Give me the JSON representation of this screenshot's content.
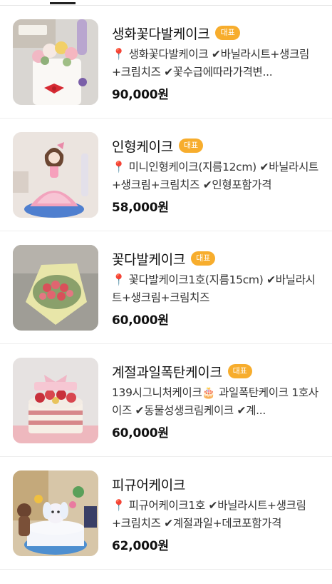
{
  "menu": {
    "items": [
      {
        "name": "생화꽃다발케이크",
        "badge": "대표",
        "description": "📍 생화꽃다발케이크 ✔바닐라시트+생크림+크림치즈 ✔꽃수급에따라가격변...",
        "price": "90,000원",
        "image_icon": "cake-flower-bouquet-photo"
      },
      {
        "name": "인형케이크",
        "badge": "대표",
        "description": "📍 미니인형케이크(지름12cm) ✔바닐라시트+생크림+크림치즈 ✔인형포함가격",
        "price": "58,000원",
        "image_icon": "doll-cake-photo"
      },
      {
        "name": "꽃다발케이크",
        "badge": "대표",
        "description": "📍 꽃다발케이크1호(지름15cm) ✔바닐라시트+생크림+크림치즈",
        "price": "60,000원",
        "image_icon": "flower-bouquet-cake-photo"
      },
      {
        "name": "계절과일폭탄케이크",
        "badge": "대표",
        "description": "139시그니처케이크🎂 과일폭탄케이크 1호사이즈 ✔동물성생크림케이크 ✔계...",
        "price": "60,000원",
        "image_icon": "fruit-bomb-cake-photo"
      },
      {
        "name": "피규어케이크",
        "badge": "",
        "description": "📍 피규어케이크1호 ✔바닐라시트+생크림+크림치즈 ✔계절과일+데코포함가격",
        "price": "62,000원",
        "image_icon": "figure-cake-photo"
      }
    ]
  },
  "colors": {
    "badge": "#f7ad2d",
    "text": "#111111",
    "divider": "#eeeeee"
  }
}
